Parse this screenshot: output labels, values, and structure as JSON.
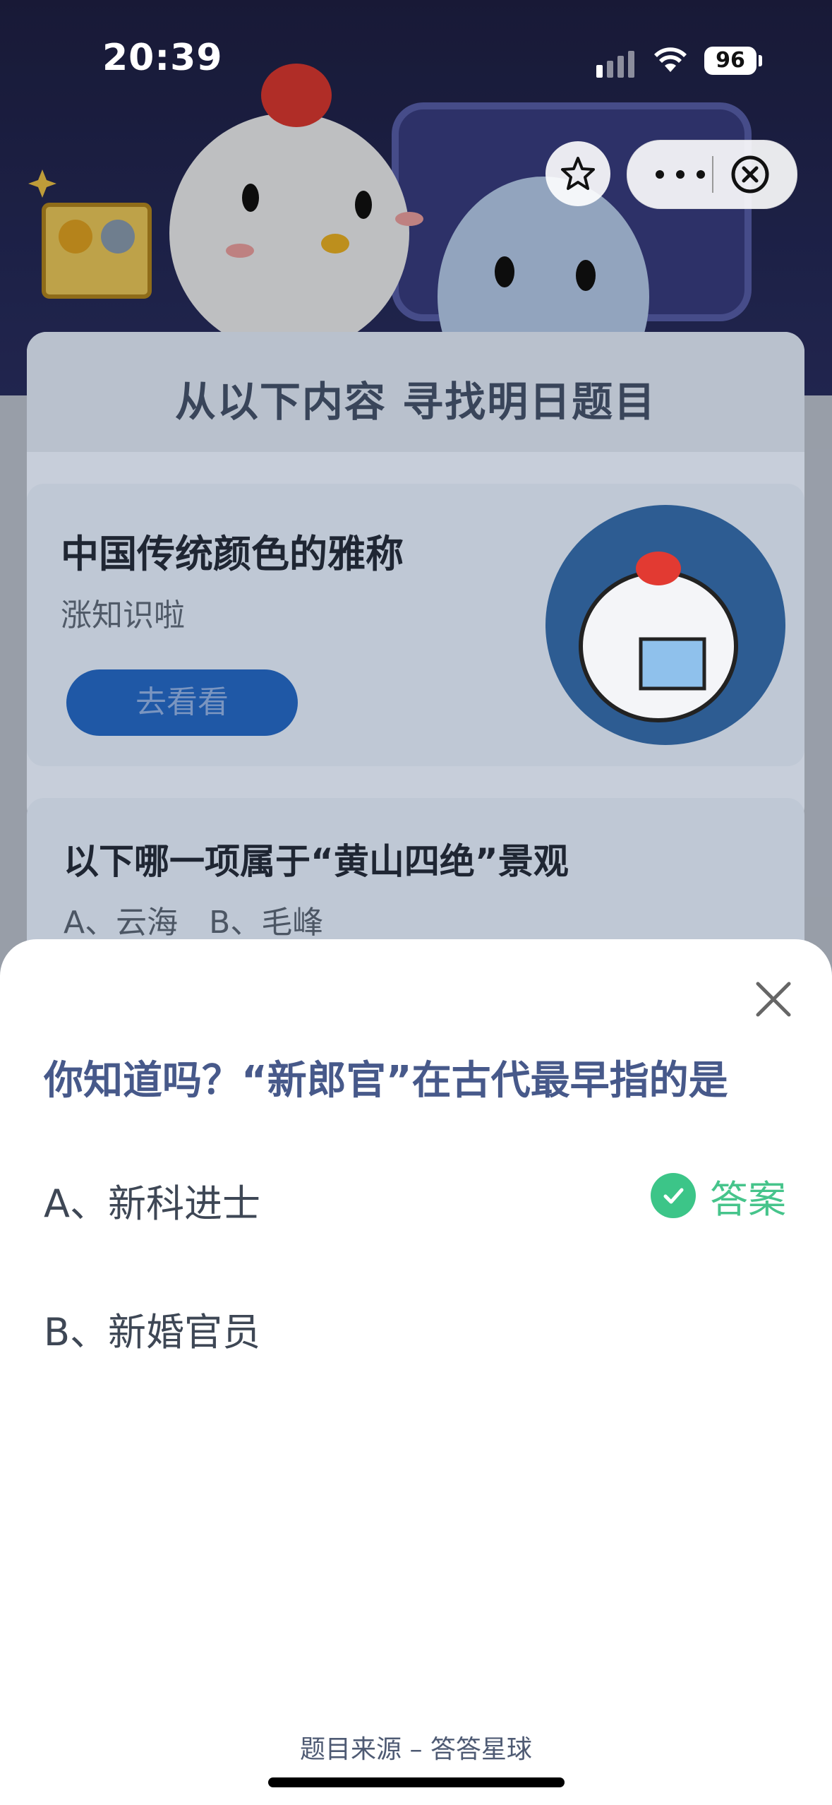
{
  "status_bar": {
    "time": "20:39",
    "battery": "96"
  },
  "background": {
    "header": "从以下内容  寻找明日题目",
    "topic_card": {
      "title": "中国传统颜色的雅称",
      "subtitle": "涨知识啦",
      "button": "去看看"
    },
    "question_card": {
      "title": "以下哪一项属于“黄山四绝”景观",
      "options": "A、云海    B、毛峰"
    }
  },
  "sheet": {
    "question": "你知道吗？“新郎官”在古代最早指的是",
    "options": [
      {
        "label": "A、新科进士",
        "is_answer": true
      },
      {
        "label": "B、新婚官员",
        "is_answer": false
      }
    ],
    "answer_label": "答案",
    "source": "题目来源 – 答答星球"
  },
  "colors": {
    "accent_green": "#3cc588",
    "question_blue": "#47598a"
  },
  "icons": [
    "star-icon",
    "more-icon",
    "close-circle-icon",
    "close-icon",
    "check-icon"
  ]
}
